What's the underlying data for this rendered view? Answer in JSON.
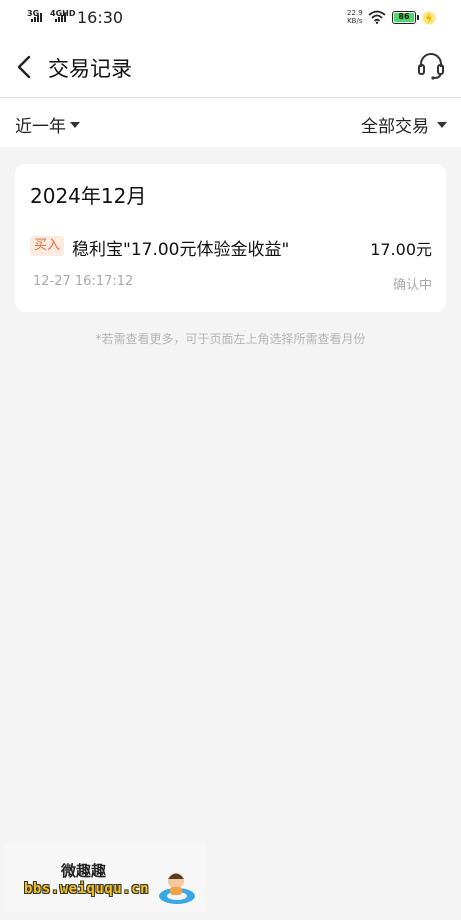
{
  "status_bar": {
    "network1": "3G",
    "network2": "4GHD",
    "time": "16:30",
    "speed_value": "22.9",
    "speed_unit": "KB/s",
    "battery": "86",
    "battery_color": "#4cd964"
  },
  "header": {
    "title": "交易记录",
    "back_icon": "chevron-left-icon",
    "service_icon": "headset-icon"
  },
  "filters": {
    "period": "近一年",
    "type": "全部交易"
  },
  "records": {
    "month": "2024年12月",
    "items": [
      {
        "tag": "买入",
        "name": "稳利宝\"17.00元体验金收益\"",
        "amount": "17.00元",
        "time": "12-27 16:17:12",
        "status": "确认中"
      }
    ]
  },
  "hint": "*若需查看更多，可于页面左上角选择所需查看月份",
  "watermark": {
    "title": "微趣趣",
    "url": "bbs.weiququ.cn"
  },
  "colors": {
    "tag_background": "#fdebe2",
    "tag_text": "#e06a3c",
    "muted_text": "#aaaaaa"
  }
}
